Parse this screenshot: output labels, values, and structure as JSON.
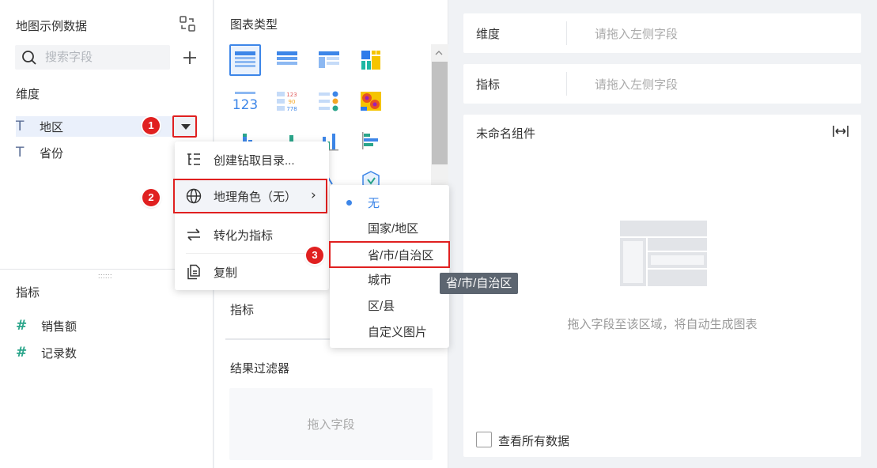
{
  "data_panel": {
    "title": "地图示例数据",
    "search_placeholder": "搜索字段",
    "dimensions_label": "维度",
    "dimensions": [
      "地区",
      "省份"
    ],
    "metrics_label": "指标",
    "metrics": [
      "销售额",
      "记录数"
    ]
  },
  "chart_panel": {
    "chart_type_label": "图表类型",
    "metric_label": "指标",
    "filter_label": "结果过滤器",
    "filter_placeholder": "拖入字段"
  },
  "context_menu": {
    "items": [
      {
        "label": "创建钻取目录...",
        "icon": "drill-tree-icon"
      },
      {
        "label": "地理角色（无）",
        "icon": "globe-icon"
      },
      {
        "label": "转化为指标",
        "icon": "swap-icon"
      },
      {
        "label": "复制",
        "icon": "copy-icon"
      }
    ]
  },
  "geo_submenu": {
    "items": [
      "无",
      "国家/地区",
      "省/市/自治区",
      "城市",
      "区/县",
      "自定义图片"
    ],
    "selected": "无",
    "tooltip": "省/市/自治区"
  },
  "canvas": {
    "dimension_slot": {
      "label": "维度",
      "placeholder": "请拖入左侧字段"
    },
    "metric_slot": {
      "label": "指标",
      "placeholder": "请拖入左侧字段"
    },
    "widget_title": "未命名组件",
    "empty_hint": "拖入字段至该区域，将自动生成图表",
    "view_all_label": "查看所有数据"
  },
  "steps": [
    "1",
    "2",
    "3"
  ],
  "colors": {
    "accent": "#3d86e8",
    "highlight": "#e02020",
    "metric_icon": "#2aa58a"
  }
}
